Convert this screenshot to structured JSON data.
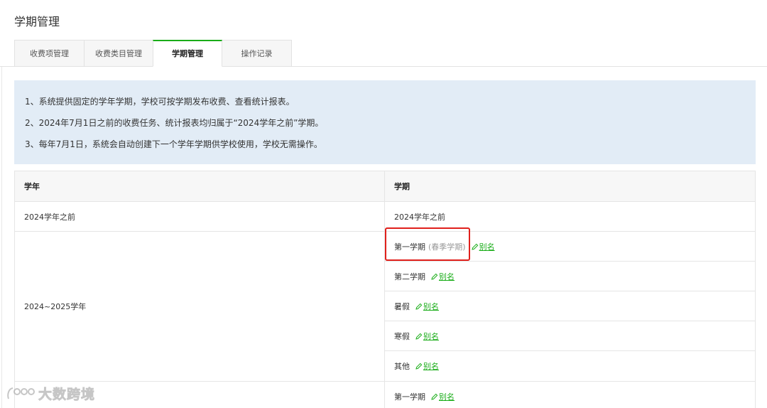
{
  "page": {
    "title": "学期管理"
  },
  "tabs": [
    {
      "label": "收费项管理",
      "active": false
    },
    {
      "label": "收费类目管理",
      "active": false
    },
    {
      "label": "学期管理",
      "active": true
    },
    {
      "label": "操作记录",
      "active": false
    }
  ],
  "notice": {
    "lines": [
      "1、系统提供固定的学年学期，学校可按学期发布收费、查看统计报表。",
      "2、2024年7月1日之前的收费任务、统计报表均归属于“2024学年之前”学期。",
      "3、每年7月1日，系统会自动创建下一个学年学期供学校使用，学校无需操作。"
    ]
  },
  "table": {
    "columns": [
      "学年",
      "学期"
    ],
    "rows": [
      {
        "year": "2024学年之前",
        "terms": [
          {
            "name": "2024学年之前",
            "hint": "",
            "alias": ""
          }
        ]
      },
      {
        "year": "2024~2025学年",
        "terms": [
          {
            "name": "第一学期",
            "hint": "(春季学期)",
            "alias": "别名"
          },
          {
            "name": "第二学期",
            "hint": "",
            "alias": "别名"
          },
          {
            "name": "暑假",
            "hint": "",
            "alias": "别名"
          },
          {
            "name": "寒假",
            "hint": "",
            "alias": "别名"
          },
          {
            "name": "其他",
            "hint": "",
            "alias": "别名"
          }
        ]
      },
      {
        "year": "",
        "terms": [
          {
            "name": "第一学期",
            "hint": "",
            "alias": "别名"
          }
        ]
      }
    ]
  },
  "watermark": {
    "text": "大数跨境"
  },
  "colors": {
    "accent": "#1aad19",
    "notice_bg": "#e2ecf6",
    "highlight": "#e0201c"
  }
}
